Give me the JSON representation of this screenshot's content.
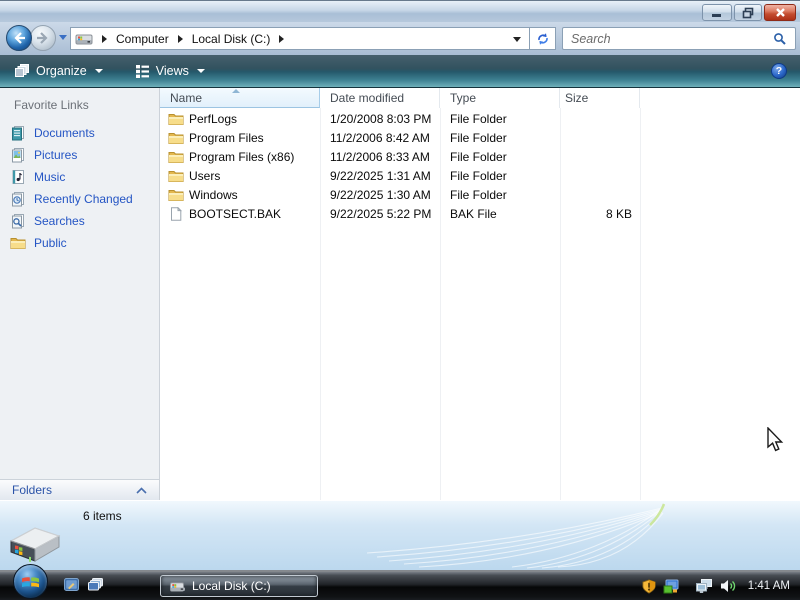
{
  "navigation": {
    "breadcrumb": {
      "items": [
        "Computer",
        "Local Disk (C:)"
      ]
    },
    "search": {
      "placeholder": "Search"
    }
  },
  "toolbar": {
    "organize_label": "Organize",
    "views_label": "Views"
  },
  "sidebar": {
    "header": "Favorite Links",
    "items": [
      {
        "label": "Documents",
        "icon": "documents-icon"
      },
      {
        "label": "Pictures",
        "icon": "pictures-icon"
      },
      {
        "label": "Music",
        "icon": "music-icon"
      },
      {
        "label": "Recently Changed",
        "icon": "recently-changed-icon"
      },
      {
        "label": "Searches",
        "icon": "searches-icon"
      },
      {
        "label": "Public",
        "icon": "public-folder-icon"
      }
    ],
    "folders_label": "Folders"
  },
  "file_list": {
    "columns": [
      "Name",
      "Date modified",
      "Type",
      "Size"
    ],
    "sort": {
      "column": "Name",
      "direction": "ascending"
    },
    "rows": [
      {
        "name": "PerfLogs",
        "date_modified": "1/20/2008 8:03 PM",
        "type": "File Folder",
        "size": "",
        "icon": "folder-icon"
      },
      {
        "name": "Program Files",
        "date_modified": "11/2/2006 8:42 AM",
        "type": "File Folder",
        "size": "",
        "icon": "folder-icon"
      },
      {
        "name": "Program Files (x86)",
        "date_modified": "11/2/2006 8:33 AM",
        "type": "File Folder",
        "size": "",
        "icon": "folder-icon"
      },
      {
        "name": "Users",
        "date_modified": "9/22/2025 1:31 AM",
        "type": "File Folder",
        "size": "",
        "icon": "folder-icon"
      },
      {
        "name": "Windows",
        "date_modified": "9/22/2025 1:30 AM",
        "type": "File Folder",
        "size": "",
        "icon": "folder-icon"
      },
      {
        "name": "BOOTSECT.BAK",
        "date_modified": "9/22/2025 5:22 PM",
        "type": "BAK File",
        "size": "8 KB",
        "icon": "bak-file-icon"
      }
    ]
  },
  "details_pane": {
    "item_count": "6 items"
  },
  "taskbar": {
    "task_button": {
      "label": "Local Disk (C:)"
    },
    "clock": "1:41 AM"
  },
  "colors": {
    "toolbar_teal": "#2e6e80",
    "link_blue": "#2455c4",
    "close_button_red": "#c44c30",
    "sorted_header_blue": "#e2f0fb",
    "taskbar_black": "#0c0d0e",
    "details_pane_blue": "#bcd8ee"
  },
  "icons": [
    "back-icon",
    "forward-icon",
    "refresh-icon",
    "search-icon",
    "hard-drive-icon",
    "folder-icon",
    "bak-file-icon",
    "help-icon",
    "organize-icon",
    "views-icon",
    "start-orb",
    "show-desktop-icon",
    "switch-windows-icon",
    "security-shield-icon",
    "tray-app-icon",
    "network-icon",
    "volume-icon",
    "cursor-arrow"
  ]
}
